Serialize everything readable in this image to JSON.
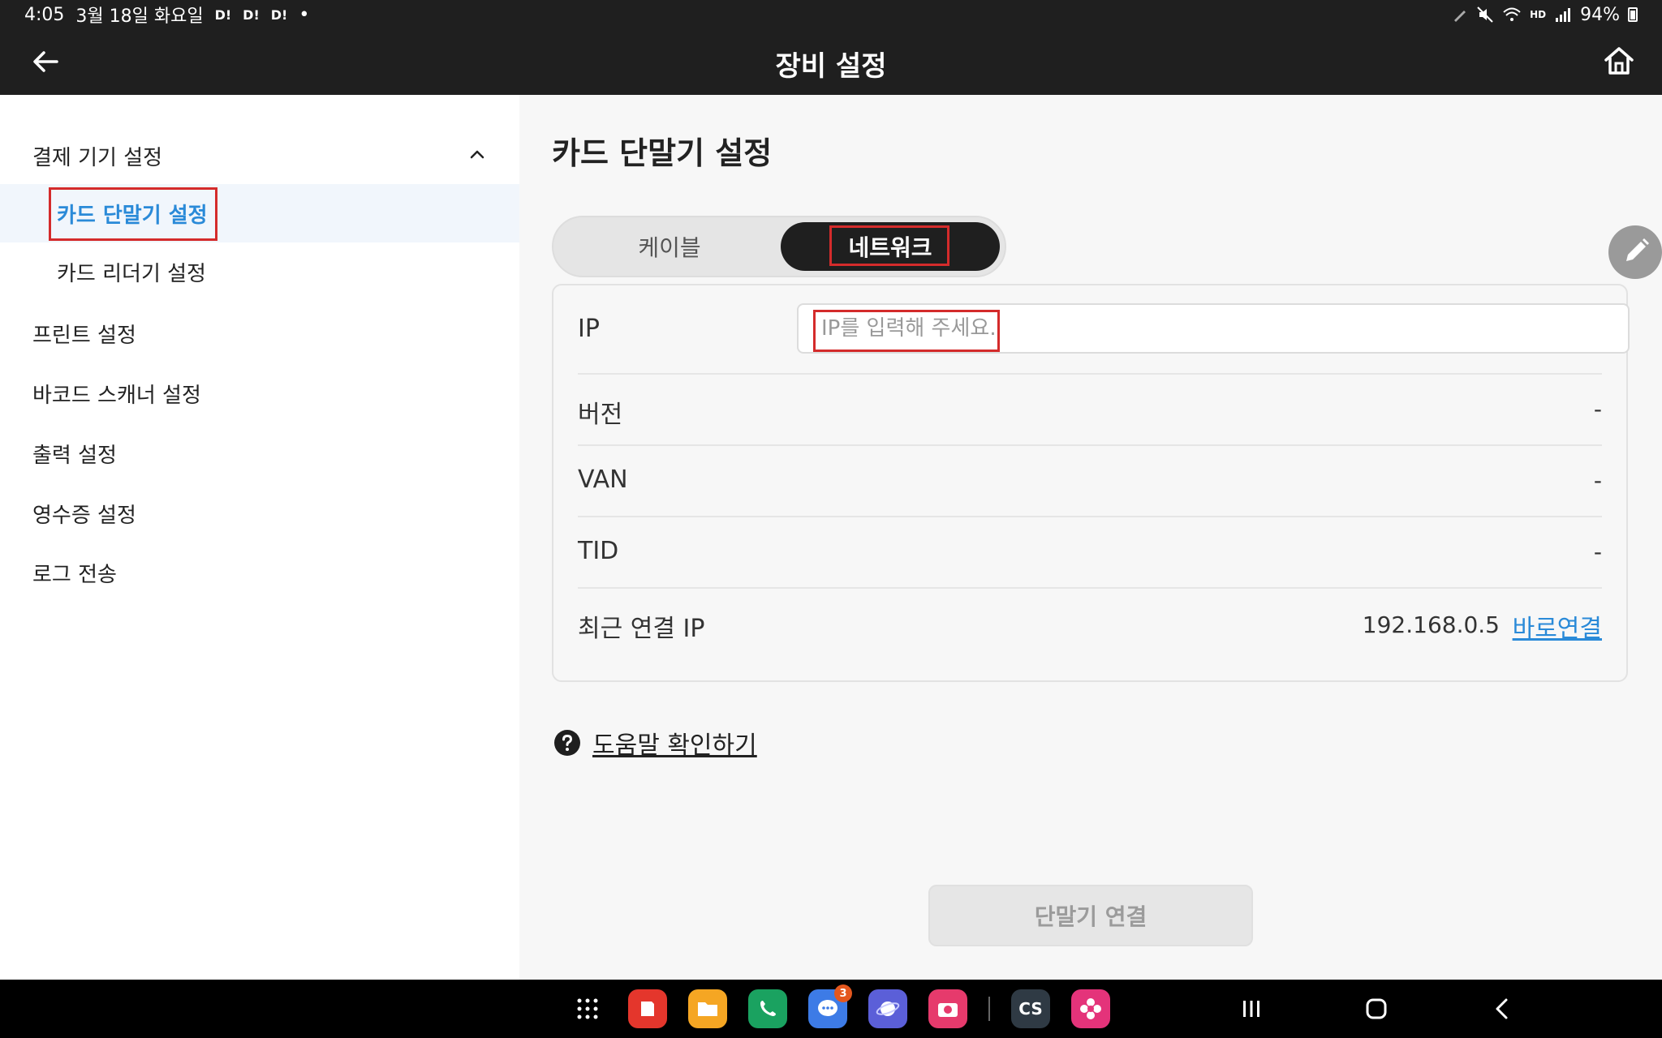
{
  "status_bar": {
    "time": "4:05",
    "date": "3월 18일 화요일",
    "badges": [
      "D!",
      "D!",
      "D!"
    ],
    "dot": "•",
    "hd_voice": "HD",
    "battery": "94%"
  },
  "header": {
    "title": "장비 설정"
  },
  "sidebar": {
    "group_label": "결제 기기 설정",
    "sub_items": [
      {
        "label": "카드 단말기 설정",
        "active": true
      },
      {
        "label": "카드 리더기 설정",
        "active": false
      }
    ],
    "items": [
      {
        "label": "프린트 설정"
      },
      {
        "label": "바코드 스캐너 설정"
      },
      {
        "label": "출력 설정"
      },
      {
        "label": "영수증 설정"
      },
      {
        "label": "로그 전송"
      }
    ]
  },
  "main": {
    "title": "카드 단말기 설정",
    "tabs": [
      {
        "label": "케이블",
        "selected": false
      },
      {
        "label": "네트워크",
        "selected": true
      }
    ],
    "ip_label": "IP",
    "ip_value": "",
    "ip_placeholder": "IP를 입력해 주세요.",
    "rows": [
      {
        "label": "버전",
        "value": "-"
      },
      {
        "label": "VAN",
        "value": "-"
      },
      {
        "label": "TID",
        "value": "-"
      }
    ],
    "recent": {
      "label": "최근 연결 IP",
      "value": "192.168.0.5",
      "link": "바로연결"
    },
    "help_label": "도움말 확인하기",
    "connect_button": "단말기 연결"
  },
  "taskbar": {
    "apps": [
      {
        "icon": "app-drawer-icon",
        "color": "#000000"
      },
      {
        "icon": "note-app-icon",
        "color": "#e4362c"
      },
      {
        "icon": "folder-app-icon",
        "color": "#f5a623"
      },
      {
        "icon": "phone-app-icon",
        "color": "#1aa260"
      },
      {
        "icon": "messages-app-icon",
        "color": "#3d7be6",
        "badge": "3"
      },
      {
        "icon": "internet-app-icon",
        "color": "#5b5fd8"
      },
      {
        "icon": "camera-app-icon",
        "color": "#e63a6c"
      },
      {
        "icon": "cs-app-icon",
        "color": "#2f3a44",
        "text": "CS"
      },
      {
        "icon": "flower-app-icon",
        "color": "#e4337a"
      }
    ]
  },
  "colors": {
    "accent": "#2a8ad8",
    "header_bg": "#1f1f1f",
    "highlight_box": "#d42b2b"
  }
}
